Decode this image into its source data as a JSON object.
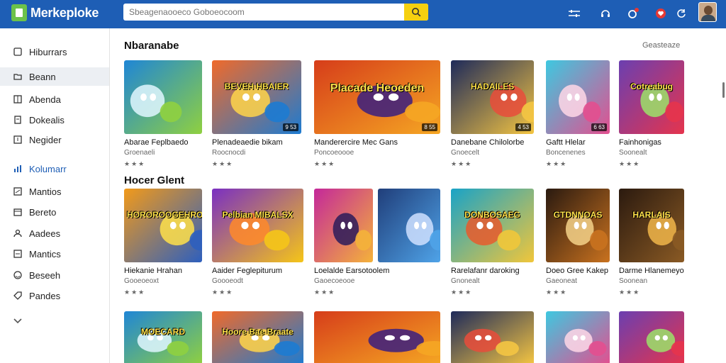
{
  "header": {
    "app_name": "Merkeploke",
    "search_placeholder": "Sbeagenaooeco Goboeocoom",
    "icons": [
      "settings-sliders-icon",
      "headset-icon",
      "notifications-icon",
      "favorites-icon",
      "refresh-icon"
    ],
    "colors": {
      "bar": "#1e5eb5",
      "search_button": "#f5d010",
      "logo": "#6cc24a"
    }
  },
  "sidebar": {
    "items": [
      {
        "label": "Hiburrars",
        "icon": "home-icon"
      },
      {
        "label": "Beann",
        "icon": "folder-icon"
      },
      {
        "label": "Abenda",
        "icon": "grid-icon"
      },
      {
        "label": "Dokealis",
        "icon": "document-icon"
      },
      {
        "label": "Negider",
        "icon": "download-icon"
      },
      {
        "label": "Kolumarr",
        "icon": "chart-icon"
      },
      {
        "label": "Mantios",
        "icon": "tools-icon"
      },
      {
        "label": "Bereto",
        "icon": "calendar-icon"
      },
      {
        "label": "Aadees",
        "icon": "person-icon"
      },
      {
        "label": "Mantics",
        "icon": "list-icon"
      },
      {
        "label": "Beseeh",
        "icon": "smile-icon"
      },
      {
        "label": "Pandes",
        "icon": "tag-icon"
      }
    ],
    "more_icon": "chevron-down-icon"
  },
  "sections": [
    {
      "title": "Nbaranabe",
      "see_all": "Geasteaze",
      "cards": [
        {
          "title": "Abarae Feplbaedo",
          "sub": "Groenaeli",
          "rating": "★★★",
          "badge": "",
          "icon": "game-thumbnail"
        },
        {
          "title": "Plenadeaedie bikam",
          "sub": "Roocnocdi",
          "rating": "★★★",
          "badge": "9 53",
          "icon": "game-thumbnail"
        },
        {
          "title": "Manderercire Mec Gans",
          "sub": "Poncoeoooe",
          "rating": "★★★",
          "badge": "8 55",
          "icon": "game-thumbnail"
        },
        {
          "title": "Danebane Chilolorbe",
          "sub": "Gnoecelt",
          "rating": "★★★",
          "badge": "4 53",
          "icon": "game-thumbnail"
        },
        {
          "title": "Gaftt Hlelar",
          "sub": "Boncenenes",
          "rating": "★★★",
          "badge": "6 63",
          "icon": "game-thumbnail"
        },
        {
          "title": "Fainhonigas",
          "sub": "Soonealt",
          "rating": "★★★",
          "badge": "",
          "icon": "game-thumbnail"
        }
      ]
    },
    {
      "title": "Hocer Glent",
      "see_all": "",
      "cards": [
        {
          "title": "Hiekanie Hrahan",
          "sub": "Gooeoeoxt",
          "rating": "★★★",
          "badge": "",
          "icon": "game-thumbnail"
        },
        {
          "title": "Aaider Feglepiturum",
          "sub": "Goooeodt",
          "rating": "★★★",
          "badge": "",
          "icon": "game-thumbnail"
        },
        {
          "title": "Loelalde Earsotoolem",
          "sub": "Gaoecoeooe",
          "rating": "★★★",
          "badge": "",
          "icon": "game-thumbnail"
        },
        {
          "title": "",
          "sub": "",
          "rating": "",
          "badge": "",
          "icon": "game-thumbnail"
        },
        {
          "title": "Rarelafanr daroking",
          "sub": "Gnonealt",
          "rating": "★★★",
          "badge": "",
          "icon": "game-thumbnail"
        },
        {
          "title": "Doeo Gree Kakep",
          "sub": "Gaeoneat",
          "rating": "★★★",
          "badge": "",
          "icon": "game-thumbnail"
        },
        {
          "title": "Darme Hlanemeyo",
          "sub": "Soonean",
          "rating": "★★★",
          "badge": "",
          "icon": "game-thumbnail"
        }
      ]
    },
    {
      "title": "",
      "see_all": "",
      "cards": [
        {
          "title": "",
          "sub": "",
          "rating": "",
          "badge": "",
          "icon": "game-thumbnail"
        },
        {
          "title": "",
          "sub": "",
          "rating": "",
          "badge": "",
          "icon": "game-thumbnail"
        },
        {
          "title": "",
          "sub": "",
          "rating": "",
          "badge": "",
          "icon": "game-thumbnail"
        },
        {
          "title": "",
          "sub": "",
          "rating": "",
          "badge": "",
          "icon": "game-thumbnail"
        },
        {
          "title": "",
          "sub": "",
          "rating": "",
          "badge": "",
          "icon": "game-thumbnail"
        },
        {
          "title": "",
          "sub": "",
          "rating": "",
          "badge": "",
          "icon": "game-thumbnail"
        }
      ]
    }
  ],
  "thumb_text": {
    "s0c1": "BEVEH HBAIER",
    "s0c2": "Placade Heoeden",
    "s0c3": "HADAILES",
    "s0c5": "Cotreabug",
    "s1c0": "HOROROOGEHRO",
    "s1c1": "Pelbian MIBALSX",
    "s1c4": "DONBOSAEG",
    "s1c5": "GTDNNOAS",
    "s1c6": "HARLAIS",
    "s2c0": "MOECARD",
    "s2c1": "Hoore Bae Braate"
  }
}
